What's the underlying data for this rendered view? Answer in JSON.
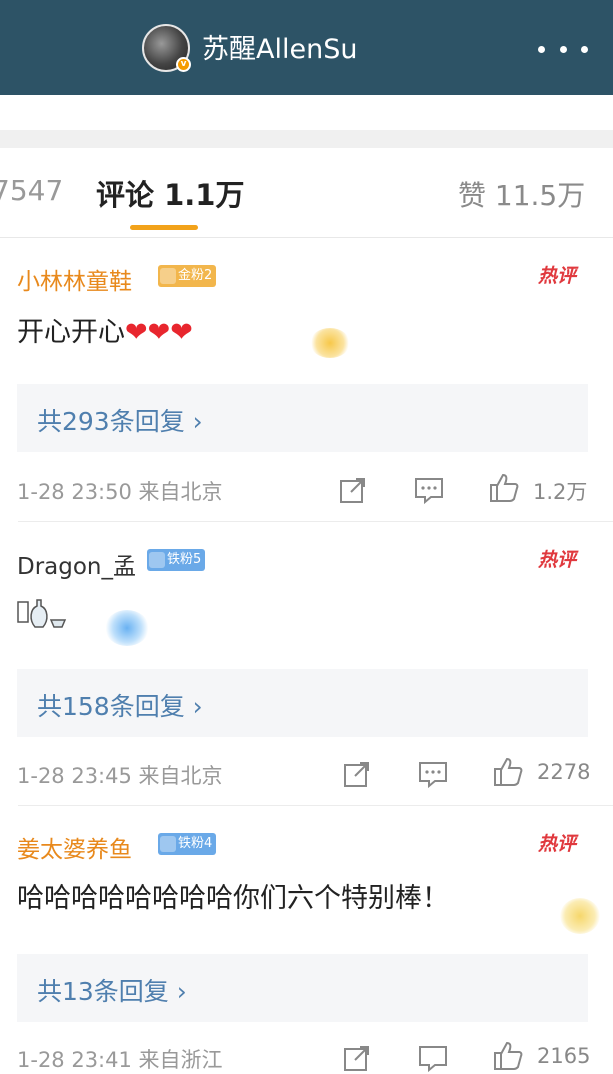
{
  "header": {
    "title": "苏醒AllenSu",
    "badge": "v"
  },
  "tabs": {
    "left": "7547",
    "comments": "评论 1.1万",
    "likes": "赞 11.5万"
  },
  "comments": [
    {
      "username": "小林林童鞋",
      "fan_badge": "金粉2",
      "hot_tag": "热评",
      "text": "开心开心",
      "hearts": "❤❤❤",
      "reply": "共293条回复 ›",
      "meta": "1-28 23:50  来自北京",
      "likes": "1.2万"
    },
    {
      "username": "Dragon_孟",
      "fan_badge": "铁粉5",
      "hot_tag": "热评",
      "text": "",
      "reply": "共158条回复 ›",
      "meta": "1-28 23:45  来自北京",
      "likes": "2278"
    },
    {
      "username": "姜太婆养鱼",
      "fan_badge": "铁粉4",
      "hot_tag": "热评",
      "text": "哈哈哈哈哈哈哈哈你们六个特别棒！",
      "reply": "共13条回复 ›",
      "meta": "1-28 23:41  来自浙江",
      "likes": "2165"
    }
  ],
  "colors": {
    "header_bg": "#2d5366",
    "accent": "#f2a21a",
    "reply_link": "#4f7fae",
    "hot_tag": "#e0393e"
  }
}
